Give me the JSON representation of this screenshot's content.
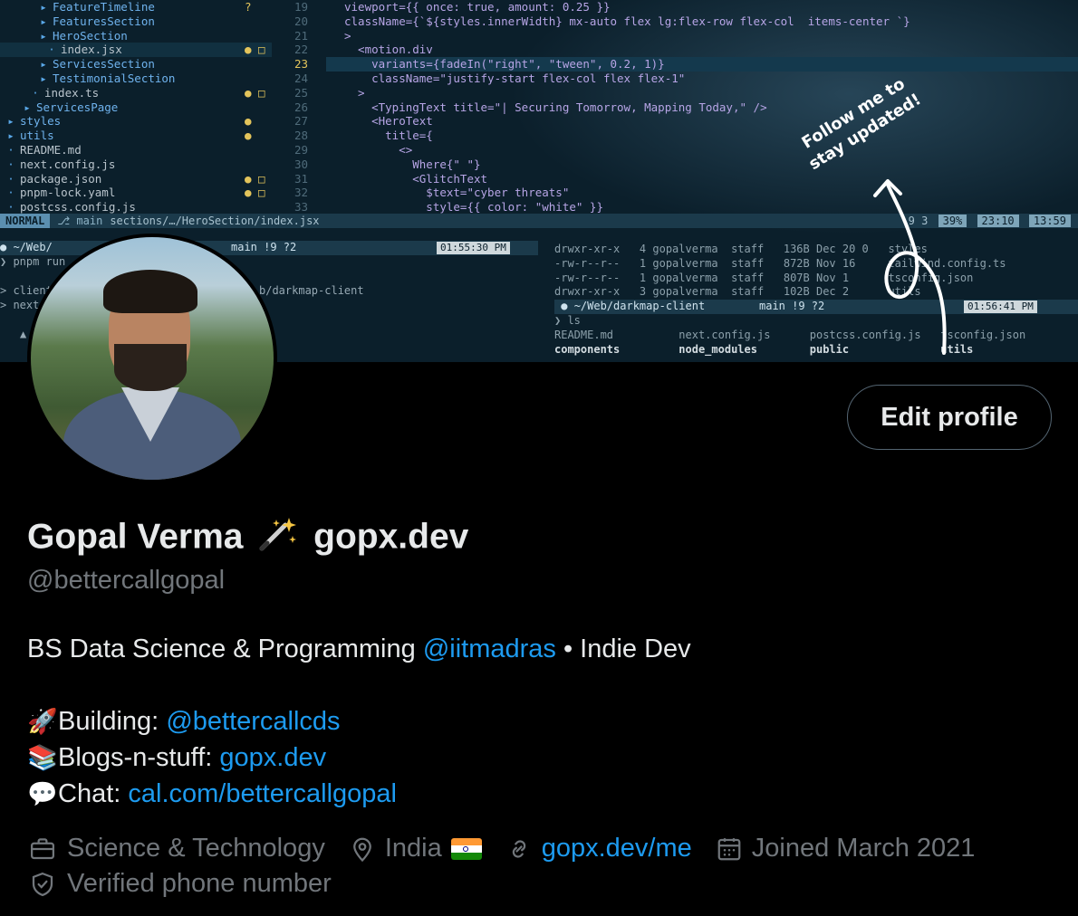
{
  "banner": {
    "tree": [
      {
        "icon": "folder-icon",
        "name": "FeatureTimeline",
        "kind": "dir",
        "marker": "?"
      },
      {
        "icon": "folder-icon",
        "name": "FeaturesSection",
        "kind": "dir",
        "marker": ""
      },
      {
        "icon": "folder-open-icon",
        "name": "HeroSection",
        "kind": "dir",
        "marker": ""
      },
      {
        "icon": "react-file-icon",
        "name": "index.jsx",
        "kind": "file",
        "marker": "● □",
        "selected": true
      },
      {
        "icon": "folder-icon",
        "name": "ServicesSection",
        "kind": "dir",
        "marker": ""
      },
      {
        "icon": "folder-icon",
        "name": "TestimonialSection",
        "kind": "dir",
        "marker": ""
      },
      {
        "icon": "ts-file-icon",
        "name": "index.ts",
        "kind": "file",
        "marker": "● □"
      },
      {
        "icon": "folder-icon",
        "name": "ServicesPage",
        "kind": "dir",
        "marker": ""
      },
      {
        "icon": "folder-icon",
        "name": "styles",
        "kind": "dir",
        "marker": "●"
      },
      {
        "icon": "folder-icon",
        "name": "utils",
        "kind": "dir",
        "marker": "●"
      },
      {
        "icon": "md-file-icon",
        "name": "README.md",
        "kind": "file",
        "marker": ""
      },
      {
        "icon": "js-file-icon",
        "name": "next.config.js",
        "kind": "file",
        "marker": ""
      },
      {
        "icon": "json-file-icon",
        "name": "package.json",
        "kind": "file",
        "marker": "● □"
      },
      {
        "icon": "yaml-file-icon",
        "name": "pnpm-lock.yaml",
        "kind": "file",
        "marker": "● □"
      },
      {
        "icon": "js-file-icon",
        "name": "postcss.config.js",
        "kind": "file",
        "marker": ""
      }
    ],
    "line_numbers": [
      "19",
      "20",
      "21",
      "22",
      "23",
      "24",
      "25",
      "26",
      "27",
      "28",
      "29",
      "30",
      "31",
      "32",
      "33"
    ],
    "current_line": "23",
    "code": [
      "viewport={{ once: true, amount: 0.25 }}",
      "className={`${styles.innerWidth} mx-auto flex lg:flex-row flex-col  items-center `}",
      ">",
      "  <motion.div",
      "    variants={fadeIn(\"right\", \"tween\", 0.2, 1)}",
      "    className=\"justify-start flex-col flex flex-1\"",
      "  >",
      "    <TypingText title=\"| Securing Tomorrow, Mapping Today,\" />",
      "    <HeroText",
      "      title={",
      "        <>",
      "          Where{\" \"}",
      "          <GlitchText",
      "            $text=\"cyber threats\"",
      "            style={{ color: \"white\" }}"
    ],
    "status": {
      "mode": "NORMAL",
      "branch": "main",
      "path": "sections/…/HeroSection/index.jsx",
      "diag": "9  3",
      "percent": "39%",
      "position": "23:10",
      "time": "13:59"
    },
    "term_left": {
      "prompt_path": "~/Web/",
      "branch_info": "main !9 ?2",
      "clock": "01:55:30 PM",
      "lines": [
        "❯ pnpm run",
        "",
        "> client",
        "> next",
        "",
        "▲"
      ],
      "path_tail": "b/darkmap-client"
    },
    "term_right": {
      "ls_lines": [
        "drwxr-xr-x   4 gopalverma  staff   136B Dec 20 0   styles",
        "-rw-r--r--   1 gopalverma  staff   872B Nov 16     tailwind.config.ts",
        "-rw-r--r--   1 gopalverma  staff   807B Nov 1      tsconfig.json",
        "drwxr-xr-x   3 gopalverma  staff   102B Dec 2      utils"
      ],
      "prompt_path": "~/Web/darkmap-client",
      "branch_info": "main !9 ?2",
      "clock": "01:56:41 PM",
      "cmd": "❯ ls",
      "files": [
        "README.md          next.config.js      postcss.config.js   tsconfig.json",
        "components         node_modules        public              utils"
      ]
    },
    "note_line1": "Follow me to",
    "note_line2": "stay updated!"
  },
  "profile": {
    "edit_button": "Edit profile",
    "name": "Gopal Verma",
    "name_suffix": "gopx.dev",
    "handle": "@bettercallgopal",
    "bio_prefix": "BS Data Science & Programming ",
    "bio_mention": "@iitmadras",
    "bio_suffix": " • Indie Dev",
    "building_label": "Building: ",
    "building_link": "@bettercallcds",
    "blogs_label": "Blogs-n-stuff: ",
    "blogs_link": "gopx.dev",
    "chat_label": "Chat: ",
    "chat_link": "cal.com/bettercallgopal",
    "emoji_building": "🚀",
    "emoji_blogs": "📚",
    "emoji_chat": "💬",
    "category": "Science & Technology",
    "location": "India",
    "website": "gopx.dev/me",
    "joined": "Joined March 2021",
    "verified": "Verified phone number"
  },
  "colors": {
    "background": "#000000",
    "text": "#e7e9ea",
    "secondary": "#71767b",
    "link": "#1d9bf0",
    "button_border": "#536471"
  }
}
